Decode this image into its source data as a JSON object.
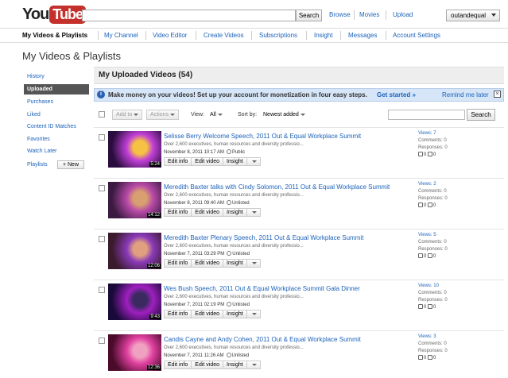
{
  "header": {
    "logo_you": "You",
    "logo_tube": "Tube",
    "search_button": "Search",
    "nav": [
      "Browse",
      "Movies",
      "Upload"
    ],
    "username": "outandequal"
  },
  "subnav": [
    "My Videos & Playlists",
    "My Channel",
    "Video Editor",
    "Create Videos",
    "Subscriptions",
    "Insight",
    "Messages",
    "Account Settings"
  ],
  "page_title": "My Videos & Playlists",
  "sidebar": {
    "items": [
      "History",
      "Uploaded",
      "Purchases",
      "Liked",
      "Content ID Matches",
      "Favorites",
      "Watch Later",
      "Playlists"
    ],
    "new_button": "+ New"
  },
  "main": {
    "title": "My Uploaded Videos (54)",
    "promo": {
      "text": "Make money on your videos! Set up your account for monetization in four easy steps.",
      "link": "Get started »",
      "remind": "Remind me later",
      "close": "×"
    },
    "toolbar": {
      "add_to": "Add to",
      "actions": "Actions",
      "view_label": "View:",
      "view_value": "All",
      "sort_label": "Sort by:",
      "sort_value": "Newest added",
      "search_button": "Search"
    }
  },
  "videos": [
    {
      "title": "Selisse Berry Welcome Speech, 2011 Out & Equal Workplace Summit",
      "desc": "Over 2,600 executives, human resources and diversity professio...",
      "date": "November 8, 2011 10:17 AM",
      "privacy": "Public",
      "duration": "5:24",
      "views": "Views: 7",
      "comments": "Comments: 0",
      "responses": "Responses: 0",
      "likes": "0",
      "dislikes": "0",
      "colors": [
        "#2a0d3f",
        "#c240d8",
        "#f6c243"
      ]
    },
    {
      "title": "Meredith Baxter talks with Cindy Solomon, 2011 Out & Equal Workplace Summit",
      "desc": "Over 2,600 executives, human resources and diversity professio...",
      "date": "November 8, 2011 09:40 AM",
      "privacy": "Unlisted",
      "duration": "14:12",
      "views": "Views: 2",
      "comments": "Comments: 0",
      "responses": "Responses: 0",
      "likes": "0",
      "dislikes": "0",
      "colors": [
        "#3a1a40",
        "#b84aa8",
        "#d8a070"
      ]
    },
    {
      "title": "Meredith Baxter Plenary Speech, 2011 Out & Equal Workplace Summit",
      "desc": "Over 2,600 executives, human resources and diversity professio...",
      "date": "November 7, 2011 03:29 PM",
      "privacy": "Unlisted",
      "duration": "12:06",
      "views": "Views: 5",
      "comments": "Comments: 0",
      "responses": "Responses: 0",
      "likes": "0",
      "dislikes": "0",
      "colors": [
        "#3a1a2c",
        "#8a3ab8",
        "#e0a080"
      ]
    },
    {
      "title": "Wes Bush Speech, 2011 Out & Equal Workplace Summit Gala Dinner",
      "desc": "Over 2,600 executives, human resources and diversity professio...",
      "date": "November 7, 2011 02:19 PM",
      "privacy": "Unlisted",
      "duration": "9:43",
      "views": "Views: 10",
      "comments": "Comments: 0",
      "responses": "Responses: 0",
      "likes": "0",
      "dislikes": "0",
      "colors": [
        "#1a0a3a",
        "#a020c0",
        "#3a2a60"
      ]
    },
    {
      "title": "Candis Cayne and Andy Cohen, 2011 Out & Equal Workplace Summit",
      "desc": "Over 2,600 executives, human resources and diversity professio...",
      "date": "November 7, 2011 11:26 AM",
      "privacy": "Unlisted",
      "duration": "12:36",
      "views": "Views: 3",
      "comments": "Comments: 0",
      "responses": "Responses: 0",
      "likes": "0",
      "dislikes": "0",
      "colors": [
        "#4a0a2a",
        "#e040a0",
        "#f0a0c0"
      ]
    }
  ],
  "row_buttons": [
    "Edit info",
    "Edit video",
    "Insight"
  ]
}
